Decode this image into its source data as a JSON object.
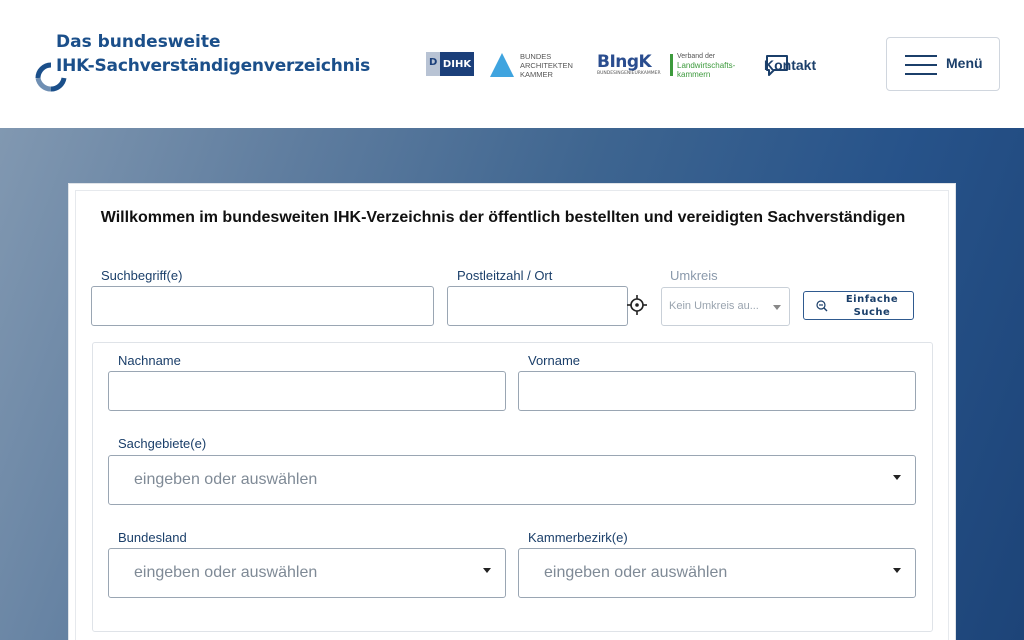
{
  "header": {
    "logo_line1": "Das bundesweite",
    "logo_line2": "IHK-Sachverständigenverzeichnis",
    "partners": {
      "dihk": "DIHK",
      "bak_line1": "BUNDES",
      "bak_line2": "ARCHITEKTEN",
      "bak_line3": "KAMMER",
      "bingk_main": "BIngK",
      "bingk_sub": "BUNDESINGENIEURKAMMER",
      "vlk_line1": "Verband der",
      "vlk_line2": "Landwirtschafts-",
      "vlk_line3": "kammern"
    },
    "contact_label": "Kontakt",
    "menu_label": "Menü"
  },
  "search": {
    "title": "Willkommen im bundesweiten IHK-Verzeichnis der öffentlich bestellten und vereidigten Sachverständigen",
    "suchbegriff_label": "Suchbegriff(e)",
    "suchbegriff_value": "",
    "plz_label": "Postleitzahl / Ort",
    "plz_value": "",
    "umkreis_label": "Umkreis",
    "umkreis_placeholder": "Kein Umkreis au...",
    "simple_search_line1": "Einfache",
    "simple_search_line2": "Suche"
  },
  "advanced": {
    "nachname_label": "Nachname",
    "nachname_value": "",
    "vorname_label": "Vorname",
    "vorname_value": "",
    "sachgebiete_label": "Sachgebiete(e)",
    "sachgebiete_placeholder": "eingeben oder auswählen",
    "bundesland_label": "Bundesland",
    "bundesland_placeholder": "eingeben oder auswählen",
    "kammerbezirk_label": "Kammerbezirk(e)",
    "kammerbezirk_placeholder": "eingeben oder auswählen"
  },
  "colors": {
    "brand": "#1b4f8a",
    "accent_blue": "#3fa4df",
    "accent_green": "#3c9a3c"
  },
  "icons": {
    "contact": "speech-bubble-icon",
    "menu": "hamburger-icon",
    "locate": "crosshair-icon",
    "simple_search": "zoom-out-icon"
  }
}
